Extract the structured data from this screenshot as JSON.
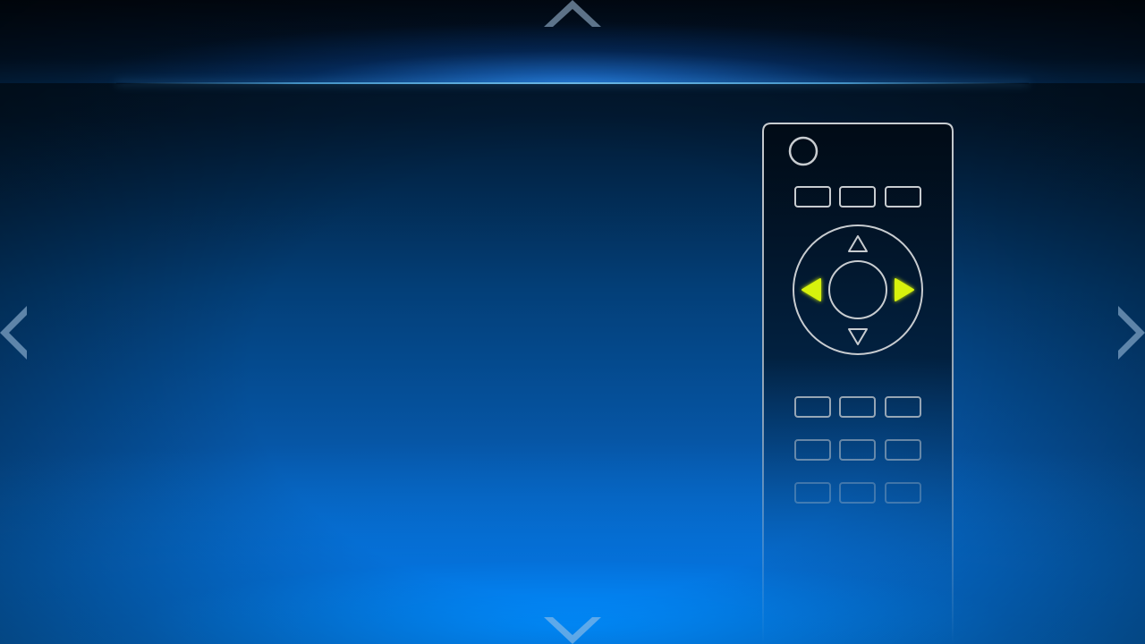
{
  "navigation": {
    "up": {
      "icon": "chevron-up-icon"
    },
    "down": {
      "icon": "chevron-down-icon"
    },
    "left": {
      "icon": "chevron-left-icon"
    },
    "right": {
      "icon": "chevron-right-icon"
    }
  },
  "remote": {
    "highlighted_keys": [
      "dpad-left",
      "dpad-right"
    ],
    "highlight_color": "#d7f20c",
    "outline_color": "#c8ccd0",
    "icons": {
      "power": "power-button-icon",
      "dpad_up": "triangle-up-icon",
      "dpad_down": "triangle-down-icon",
      "dpad_left": "triangle-left-icon",
      "dpad_right": "triangle-right-icon"
    }
  },
  "colors": {
    "background_top": "#02101f",
    "background_bottom": "#0b84ea",
    "glow": "#5ab4ff"
  }
}
